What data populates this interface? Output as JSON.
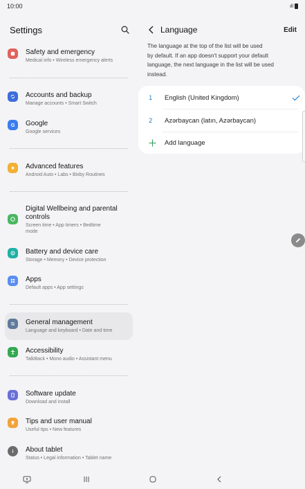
{
  "status_bar": {
    "time": "10:00",
    "signal": "ıll"
  },
  "settings": {
    "title": "Settings",
    "items": [
      {
        "title": "Safety and emergency",
        "subtitle": "Medical info  •  Wireless emergency alerts",
        "icon": "alert-icon",
        "color": "#e0615b"
      },
      {
        "title": "Accounts and backup",
        "subtitle": "Manage accounts  •  Smart Switch",
        "icon": "sync-icon",
        "color": "#3d6dda"
      },
      {
        "title": "Google",
        "subtitle": "Google services",
        "icon": "google-icon",
        "color": "#3b7cf1"
      },
      {
        "title": "Advanced features",
        "subtitle": "Android Auto  •  Labs  •  Bixby Routines",
        "icon": "star-icon",
        "color": "#f2b134"
      },
      {
        "title_line1": "Digital Wellbeing and parental",
        "title_line2": "controls",
        "subtitle_line1": "Screen time  •  App timers  •  Bedtime",
        "subtitle_line2": "mode",
        "icon": "heart-icon",
        "color": "#4ab662"
      },
      {
        "title": "Battery and device care",
        "subtitle": "Storage  •  Memory  •  Device protection",
        "icon": "battery-care-icon",
        "color": "#1fb0a4"
      },
      {
        "title": "Apps",
        "subtitle": "Default apps  •  App settings",
        "icon": "apps-icon",
        "color": "#5a8ef0"
      },
      {
        "title": "General management",
        "subtitle": "Language and keyboard  •  Date and time",
        "icon": "sliders-icon",
        "color": "#5f7a9a"
      },
      {
        "title": "Accessibility",
        "subtitle": "TalkBack  •  Mono audio  •  Assistant menu",
        "icon": "accessibility-icon",
        "color": "#32a852"
      },
      {
        "title": "Software update",
        "subtitle": "Download and install",
        "icon": "update-icon",
        "color": "#6a6fd8"
      },
      {
        "title": "Tips and user manual",
        "subtitle": "Useful tips  •  New features",
        "icon": "bulb-icon",
        "color": "#f2a33a"
      },
      {
        "title": "About tablet",
        "subtitle": "Status  •  Legal information  •  Tablet name",
        "icon": "info-icon",
        "color": "#6b6b6b"
      }
    ]
  },
  "language": {
    "title": "Language",
    "edit_label": "Edit",
    "description_lines": [
      "The language at the top of the list will be used",
      "by default. If an app doesn't support your default",
      "language, the next language in the list will be used",
      "instead."
    ],
    "languages": [
      {
        "number": "1",
        "name": "English (United Kingdom)"
      },
      {
        "number": "2",
        "name": "Azərbaycan (latın, Azərbaycan)"
      }
    ],
    "add_label": "Add language"
  },
  "colors": {
    "accent": "#1f80c8",
    "add": "#2c9c5a",
    "background": "#f4f4f6"
  }
}
